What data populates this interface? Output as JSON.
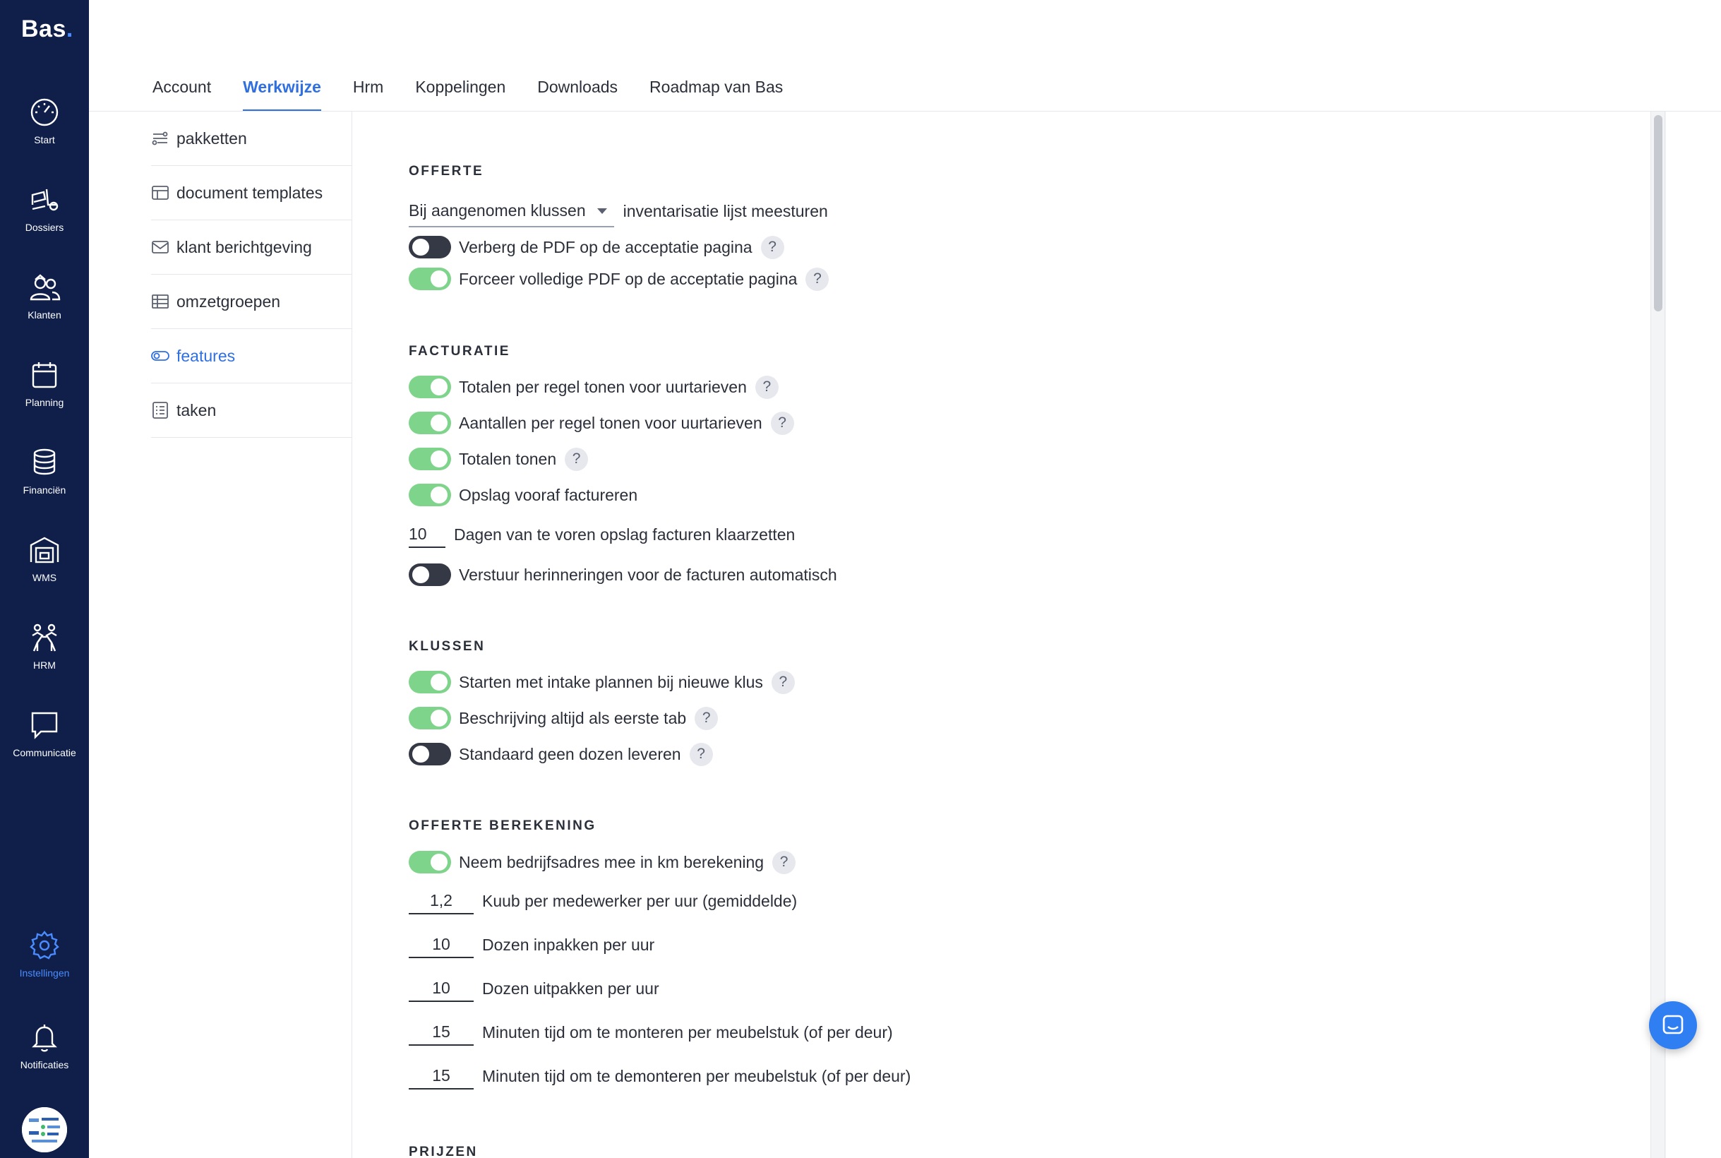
{
  "brand": {
    "name": "Bas",
    "dot": "."
  },
  "nav": [
    {
      "label": "Start",
      "icon": "dashboard-gauge-icon"
    },
    {
      "label": "Dossiers",
      "icon": "moving-truck-icon"
    },
    {
      "label": "Klanten",
      "icon": "customers-icon"
    },
    {
      "label": "Planning",
      "icon": "calendar-icon"
    },
    {
      "label": "Financiën",
      "icon": "coins-stack-icon"
    },
    {
      "label": "WMS",
      "icon": "warehouse-icon"
    },
    {
      "label": "HRM",
      "icon": "people-icon"
    },
    {
      "label": "Communicatie",
      "icon": "chat-bubble-icon"
    },
    {
      "label": "Instellingen",
      "icon": "settings-gear-icon",
      "active": true
    },
    {
      "label": "Notificaties",
      "icon": "bell-icon"
    }
  ],
  "tabs": [
    {
      "label": "Account"
    },
    {
      "label": "Werkwijze",
      "active": true
    },
    {
      "label": "Hrm"
    },
    {
      "label": "Koppelingen"
    },
    {
      "label": "Downloads"
    },
    {
      "label": "Roadmap van Bas"
    }
  ],
  "subnav": [
    {
      "label": "pakketten",
      "icon": "packages-icon"
    },
    {
      "label": "document templates",
      "icon": "template-icon"
    },
    {
      "label": "klant berichtgeving",
      "icon": "envelope-icon"
    },
    {
      "label": "omzetgroepen",
      "icon": "table-icon"
    },
    {
      "label": "features",
      "icon": "toggle-icon",
      "active": true
    },
    {
      "label": "taken",
      "icon": "checklist-icon"
    }
  ],
  "offerte": {
    "title": "OFFERTE",
    "select_value": "Bij aangenomen klussen",
    "select_suffix": "inventarisatie lijst meesturen",
    "toggles": [
      {
        "label": "Verberg de PDF op de acceptatie pagina",
        "on": false
      },
      {
        "label": "Forceer volledige PDF op de acceptatie pagina",
        "on": true
      }
    ]
  },
  "facturatie": {
    "title": "FACTURATIE",
    "toggles": [
      {
        "label": "Totalen per regel tonen voor uurtarieven",
        "on": true
      },
      {
        "label": "Aantallen per regel tonen voor uurtarieven",
        "on": true
      },
      {
        "label": "Totalen tonen",
        "on": true
      },
      {
        "label": "Opslag vooraf factureren",
        "on": true
      }
    ],
    "days_value": "10",
    "days_label": "Dagen van te voren opslag facturen klaarzetten",
    "reminder": {
      "label": "Verstuur herinneringen voor de facturen automatisch",
      "on": false
    }
  },
  "klussen": {
    "title": "KLUSSEN",
    "toggles": [
      {
        "label": "Starten met intake plannen bij nieuwe klus",
        "on": true
      },
      {
        "label": "Beschrijving altijd als eerste tab",
        "on": true
      },
      {
        "label": "Standaard geen dozen leveren",
        "on": false
      }
    ]
  },
  "berekening": {
    "title": "OFFERTE BEREKENING",
    "toggle": {
      "label": "Neem bedrijfsadres mee in km berekening",
      "on": true
    },
    "inputs": [
      {
        "value": "1,2",
        "label": "Kuub per medewerker per uur (gemiddelde)"
      },
      {
        "value": "10",
        "label": "Dozen inpakken per uur"
      },
      {
        "value": "10",
        "label": "Dozen uitpakken per uur"
      },
      {
        "value": "15",
        "label": "Minuten tijd om te monteren per meubelstuk (of per deur)"
      },
      {
        "value": "15",
        "label": "Minuten tijd om te demonteren per meubelstuk (of per deur)"
      }
    ]
  },
  "prijzen": {
    "title": "PRIJZEN"
  },
  "help_glyph": "?",
  "colors": {
    "sidebar": "#0f1f4a",
    "accent": "#2f6fe0",
    "toggle_on": "#7ed48a",
    "toggle_off": "#353845"
  }
}
